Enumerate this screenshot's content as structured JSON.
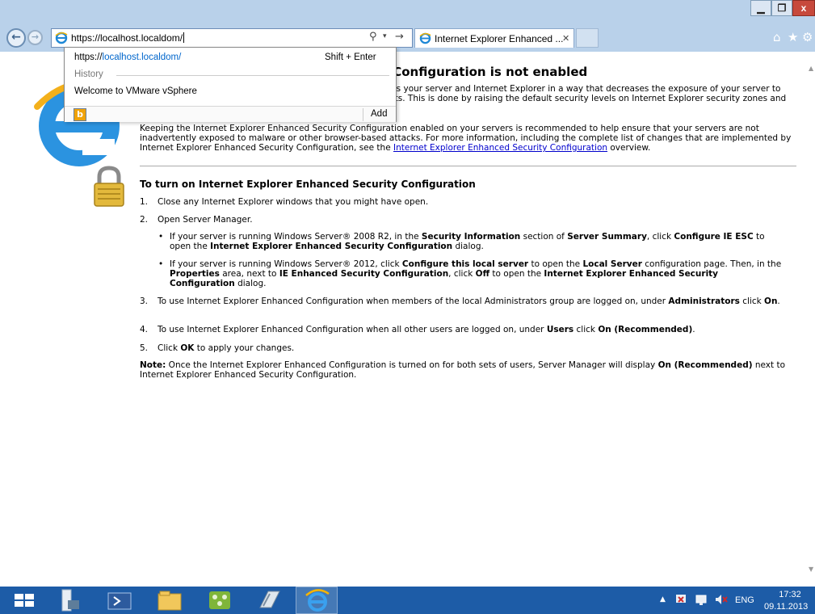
{
  "window": {
    "min_glyph": "▁",
    "max_glyph": "❐",
    "close_glyph": "x"
  },
  "nav": {
    "back_glyph": "←",
    "forward_glyph": "→"
  },
  "address_bar": {
    "url": "https://localhost.localdom/",
    "search_glyph": "⚲",
    "dropdown_glyph": "▾",
    "go_glyph": "→"
  },
  "tabs": [
    {
      "label": "Internet Explorer Enhanced ...",
      "close_glyph": "✕",
      "active": true
    }
  ],
  "toolbar": {
    "home_glyph": "⌂",
    "favorites_glyph": "★",
    "tools_glyph": "⚙"
  },
  "autocomplete": {
    "url_prefix": "https://",
    "url_highlight": "localhost.localdom/",
    "shortcut": "Shift + Enter",
    "history_label": "History",
    "history_items": [
      "Welcome to VMware vSphere"
    ],
    "bing_glyph": "b",
    "add_label": "Add"
  },
  "page": {
    "title": "Internet Explorer Enhanced Security Configuration is not enabled",
    "intro": "Internet Explorer Enhanced Security Configuration configures your server and Internet Explorer in a way that decreases the exposure of your server to potential attacks through Web content and application scripts. This is done by raising the default security levels on Internet Explorer security zones and changing default Internet Explorer settings.",
    "keeping_1": "Keeping the Internet Explorer Enhanced Security Configuration enabled on your servers is recommended to help ensure that your servers are not inadvertently exposed to malware or other browser-based attacks. For more information, including the complete list of changes that are implemented by Internet Explorer Enhanced Security Configuration, see the ",
    "keeping_link": "Internet Explorer Enhanced Security Configuration",
    "keeping_2": " overview.",
    "section_title": "To turn on Internet Explorer Enhanced Security Configuration",
    "step1_num": "1.",
    "step1": "Close any Internet Explorer windows that you might have open.",
    "step2_num": "2.",
    "step2": "Open Server Manager.",
    "bullet_glyph": "•",
    "b1_a": "If your server is running Windows Server® 2008 R2, in the ",
    "b1_b": "Security Information",
    "b1_c": " section of ",
    "b1_d": "Server Summary",
    "b1_e": ", click ",
    "b1_f": "Configure IE ESC",
    "b1_g": " to open the ",
    "b1_h": "Internet Explorer Enhanced Security Configuration",
    "b1_i": " dialog.",
    "b2_a": "If your server is running Windows Server® 2012, click ",
    "b2_b": "Configure this local server",
    "b2_c": " to open the ",
    "b2_d": "Local Server",
    "b2_e": " configuration page. Then, in the ",
    "b2_f": "Properties",
    "b2_g": " area, next to ",
    "b2_h": "IE Enhanced Security Configuration",
    "b2_i": ", click ",
    "b2_j": "Off",
    "b2_k": " to open the ",
    "b2_l": "Internet Explorer Enhanced Security Configuration",
    "b2_m": " dialog.",
    "step3_num": "3.",
    "s3_a": "To use Internet Explorer Enhanced Configuration when members of the local Administrators group are logged on, under ",
    "s3_b": "Administrators",
    "s3_c": " click ",
    "s3_d": "On",
    "s3_e": ".",
    "step4_num": "4.",
    "s4_a": "To use Internet Explorer Enhanced Configuration when all other users are logged on, under ",
    "s4_b": "Users",
    "s4_c": " click ",
    "s4_d": "On (Recommended)",
    "s4_e": ".",
    "step5_num": "5.",
    "s5_a": "Click ",
    "s5_b": "OK",
    "s5_c": " to apply your changes.",
    "note_label": "Note:",
    "note_a": " Once the Internet Explorer Enhanced Configuration is turned on for both sets of users, Server Manager will display ",
    "note_b": "On (Recommended)",
    "note_c": " next to Internet Explorer Enhanced Security Configuration."
  },
  "scrollbar": {
    "up_glyph": "▲",
    "down_glyph": "▼"
  },
  "taskbar": {
    "tray_arrow": "▲",
    "language": "ENG",
    "time": "17:32",
    "date": "09.11.2013"
  }
}
